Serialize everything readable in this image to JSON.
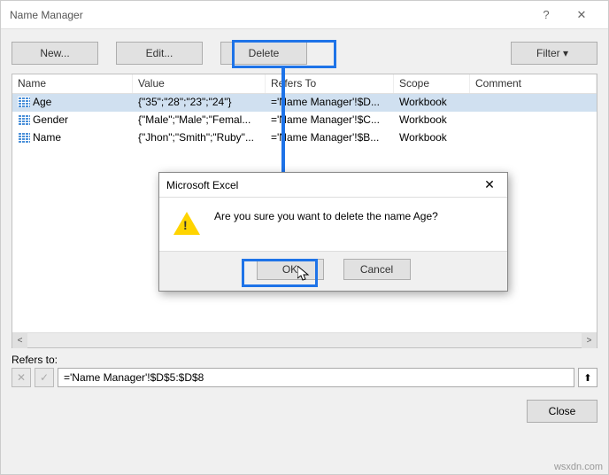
{
  "window": {
    "title": "Name Manager"
  },
  "toolbar": {
    "new": "New...",
    "edit": "Edit...",
    "delete": "Delete",
    "filter": "Filter ▾"
  },
  "grid": {
    "headers": {
      "name": "Name",
      "value": "Value",
      "refers": "Refers To",
      "scope": "Scope",
      "comment": "Comment"
    },
    "rows": [
      {
        "name": "Age",
        "value": "{\"35\";\"28\";\"23\";\"24\"}",
        "refers": "='Name Manager'!$D...",
        "scope": "Workbook",
        "selected": true
      },
      {
        "name": "Gender",
        "value": "{\"Male\";\"Male\";\"Femal...",
        "refers": "='Name Manager'!$C...",
        "scope": "Workbook",
        "selected": false
      },
      {
        "name": "Name",
        "value": "{\"Jhon\";\"Smith\";\"Ruby\"...",
        "refers": "='Name Manager'!$B...",
        "scope": "Workbook",
        "selected": false
      }
    ]
  },
  "refersto": {
    "label": "Refers to:",
    "value": "='Name Manager'!$D$5:$D$8"
  },
  "footer": {
    "close": "Close"
  },
  "msgbox": {
    "title": "Microsoft Excel",
    "text": "Are you sure you want to delete the name Age?",
    "ok": "OK",
    "cancel": "Cancel"
  },
  "watermark": "wsxdn.com"
}
